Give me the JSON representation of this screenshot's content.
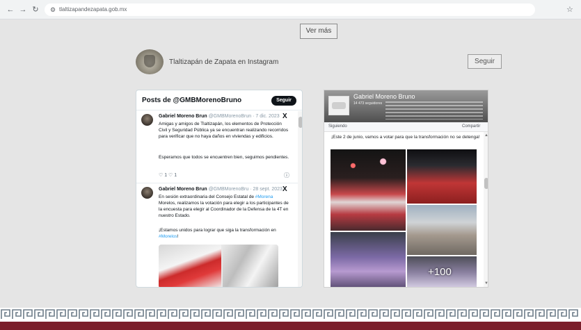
{
  "browser": {
    "back_icon": "←",
    "forward_icon": "→",
    "reload_icon": "↻",
    "site_info_icon": "⚙",
    "url": "tlaltizapandezapata.gob.mx",
    "bookmark_icon": "☆"
  },
  "ver_mas_label": "Ver más",
  "instagram": {
    "title": "Tlaltizapán de Zapata en Instagram",
    "follow_label": "Seguir"
  },
  "twitter": {
    "title": "Posts de @GMBMorenoBruno",
    "follow_label": "Seguir",
    "tweets": [
      {
        "name": "Gabriel Moreno Brun",
        "handle": "@GMBMorenoBrun · 7 dic. 2023",
        "text": "Amigas y amigos de Tlaltizapán, los elementos de Protección Civil y Seguridad Pública ya se encuentran realizando recorridos para verificar que no haya daños en viviendas y edificios.",
        "text2": "Esperamos que todos se encuentren bien, seguimos pendientes.",
        "actions": "♡ 1  ♡ 1",
        "info": "ⓘ"
      },
      {
        "name": "Gabriel Moreno Brun",
        "handle": "@GMBMorenoBru · 28 sept. 2023",
        "text_prefix": "En sesión extraordinaria del Consejo Estatal de ",
        "text_link": "#Morena",
        "text_suffix": " Morelos, realizamos la votación para elegir a los participantes de la encuesta para elegir al Coordinador de la Defensa de la 4T en nuestro Estado.",
        "text2": "¡Estamos unidos para lograr que siga la transformación en ",
        "text2_link": "#Morelos",
        "text2_end": "!"
      }
    ],
    "x_icon": "X"
  },
  "facebook": {
    "page_name": "Gabriel Moreno Bruno",
    "followers": "14 473 seguidores",
    "following_label": "Siguiendo",
    "share_label": "Compartir",
    "post_text": "¡Este 2 de junio, vamos a votar para que la transformación no se detenga!",
    "more_photos": "+100",
    "scroll_up": "▲",
    "scroll_down": "▼"
  },
  "footer": {
    "pattern": "卐ᄅ卐ᄅ卐ᄅ"
  }
}
